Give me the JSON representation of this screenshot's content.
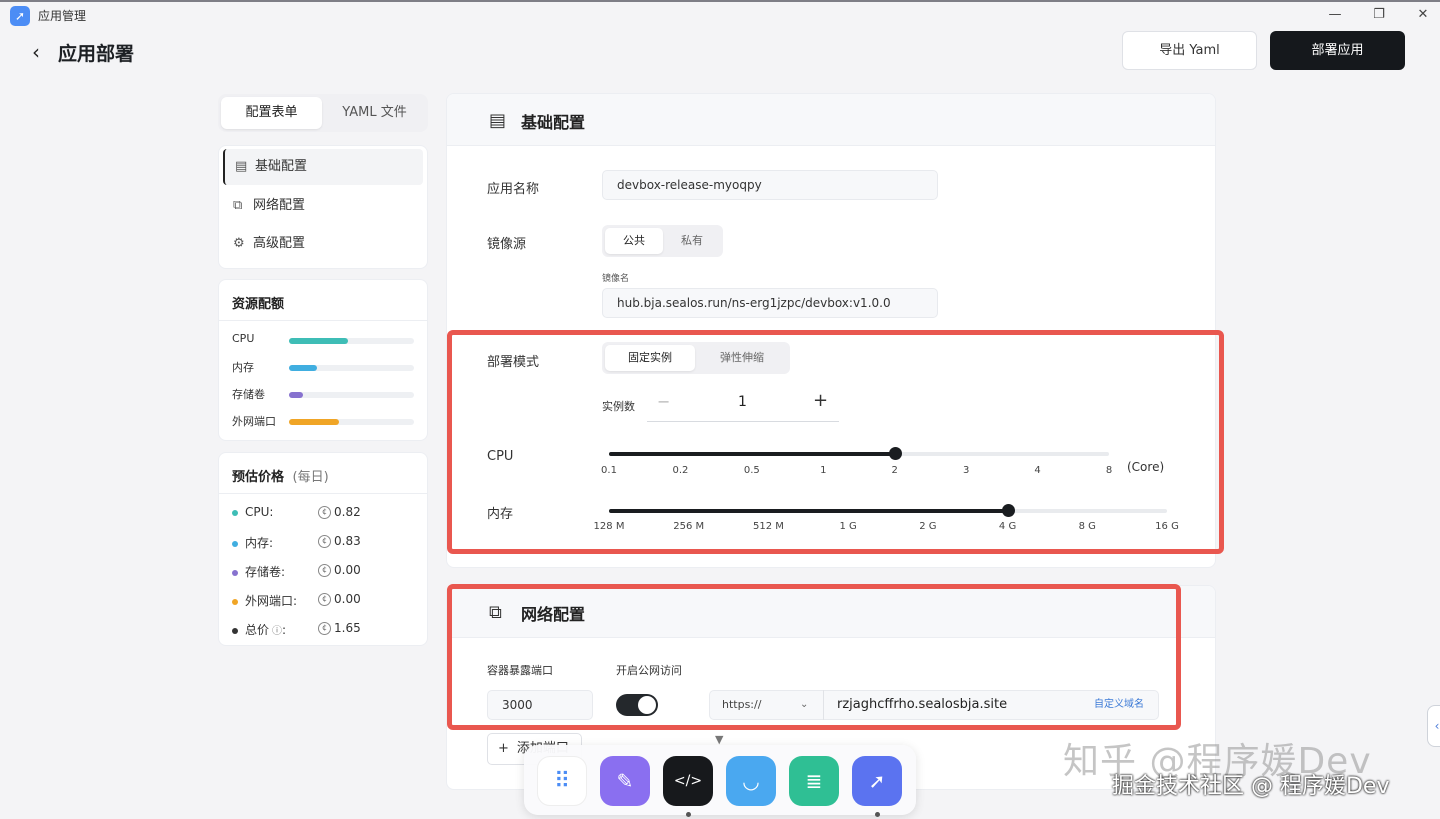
{
  "window": {
    "app_title": "应用管理",
    "minimize": "—",
    "restore": "❐",
    "close": "✕"
  },
  "header": {
    "title": "应用部署",
    "export_label": "导出 Yaml",
    "deploy_label": "部署应用"
  },
  "tabs": [
    {
      "label": "配置表单"
    },
    {
      "label": "YAML 文件"
    }
  ],
  "nav": [
    {
      "label": "基础配置"
    },
    {
      "label": "网络配置"
    },
    {
      "label": "高级配置"
    }
  ],
  "quota": {
    "title": "资源配额",
    "items": [
      {
        "label": "CPU",
        "fraction": 0.47,
        "color": "#3ebdb6"
      },
      {
        "label": "内存",
        "fraction": 0.22,
        "color": "#40aee0"
      },
      {
        "label": "存储卷",
        "fraction": 0.11,
        "color": "#8772cf"
      },
      {
        "label": "外网端口",
        "fraction": 0.4,
        "color": "#f0a526"
      }
    ]
  },
  "price": {
    "title": "预估价格",
    "subtitle": "(每日)",
    "items": [
      {
        "label": "CPU:",
        "value": "0.82",
        "color": "#3ebdb6"
      },
      {
        "label": "内存:",
        "value": "0.83",
        "color": "#40aee0"
      },
      {
        "label": "存储卷:",
        "value": "0.00",
        "color": "#8772cf"
      },
      {
        "label": "外网端口:",
        "value": "0.00",
        "color": "#f0a526"
      },
      {
        "label": "总价",
        "value": "1.65",
        "color": "#333333"
      }
    ]
  },
  "basic": {
    "title": "基础配置",
    "app_name_label": "应用名称",
    "app_name_value": "devbox-release-myoqpy",
    "image_source_label": "镜像源",
    "image_source_options": [
      "公共",
      "私有"
    ],
    "image_name_label": "镜像名",
    "image_name_value": "hub.bja.sealos.run/ns-erg1jzpc/devbox:v1.0.0",
    "deploy_mode_label": "部署模式",
    "deploy_mode_options": [
      "固定实例",
      "弹性伸缩"
    ],
    "instances_label": "实例数",
    "instances_value": "1",
    "minus": "−",
    "plus": "+",
    "cpu_label": "CPU",
    "cpu_ticks": [
      "0.1",
      "0.2",
      "0.5",
      "1",
      "2",
      "3",
      "4",
      "8"
    ],
    "cpu_selected": "2",
    "cpu_unit": "(Core)",
    "mem_label": "内存",
    "mem_ticks": [
      "128 M",
      "256 M",
      "512 M",
      "1 G",
      "2 G",
      "4 G",
      "8 G",
      "16 G"
    ],
    "mem_selected": "4 G"
  },
  "network": {
    "title": "网络配置",
    "port_label": "容器暴露端口",
    "public_label": "开启公网访问",
    "port_value": "3000",
    "public_enabled": true,
    "protocol": "https://",
    "domain": "rzjaghcffrho.sealosbja.site",
    "custom_domain": "自定义域名",
    "add_port": "添加端口"
  },
  "watermark": {
    "line1": "知乎 @程序媛Dev",
    "line2": "掘金技术社区 @ 程序媛Dev"
  }
}
